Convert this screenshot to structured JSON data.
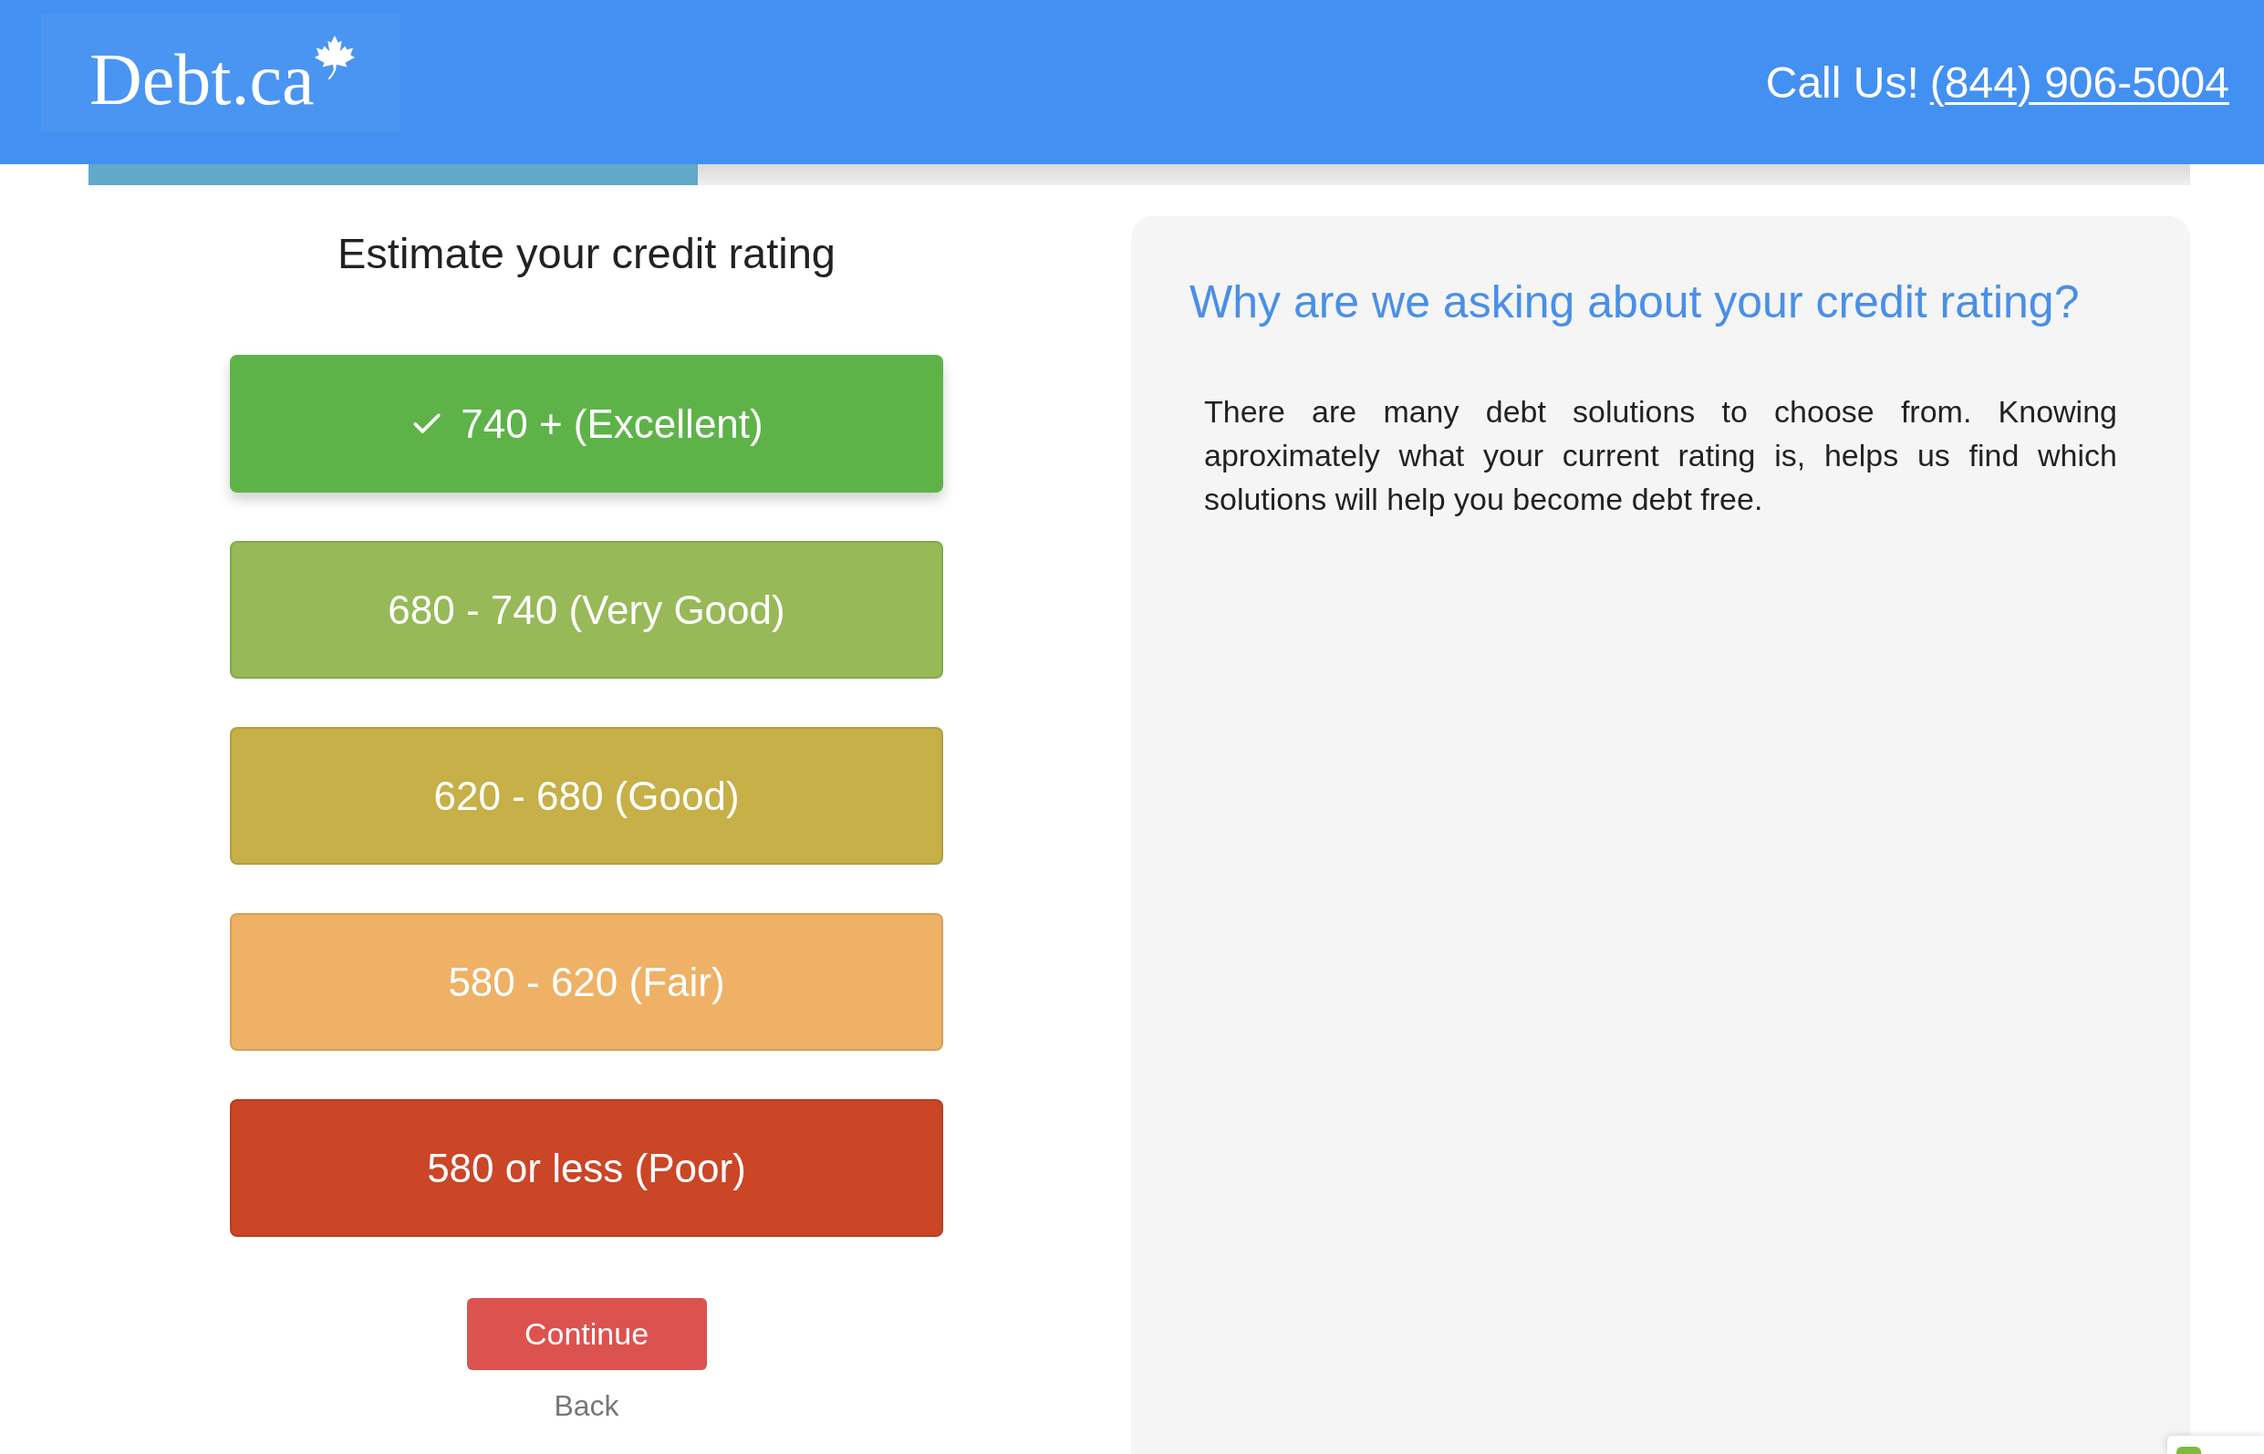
{
  "header": {
    "logo": "Debt.ca",
    "call_label": "Call Us!",
    "phone": "(844) 906-5004"
  },
  "progress": {
    "level": 0.29
  },
  "question": {
    "title": "Estimate your credit rating",
    "options": [
      {
        "label": "740 + (Excellent)",
        "selected": true,
        "color": "#5db348"
      },
      {
        "label": "680 - 740 (Very Good)",
        "selected": false,
        "color": "#97b957"
      },
      {
        "label": "620 - 680 (Good)",
        "selected": false,
        "color": "#c6b047"
      },
      {
        "label": "580 - 620 (Fair)",
        "selected": false,
        "color": "#efb165"
      },
      {
        "label": "580 or less (Poor)",
        "selected": false,
        "color": "#cb4527"
      }
    ],
    "continue": "Continue",
    "back": "Back"
  },
  "info": {
    "title": "Why are we asking about your credit rating?",
    "text": "There are many debt solutions to choose from. Knowing aproximately what your current rating is, helps us find which solutions will help you become debt free."
  }
}
